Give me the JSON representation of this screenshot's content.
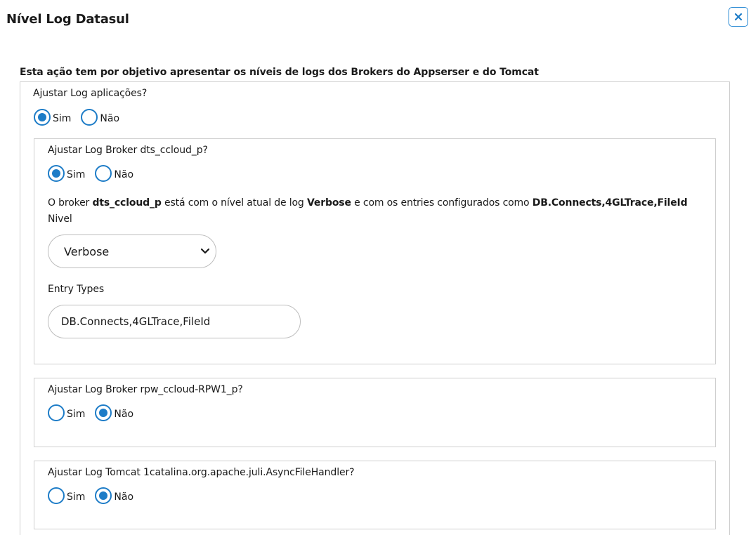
{
  "dialog": {
    "title": "Nível Log Datasul",
    "close_icon": "close-icon"
  },
  "description": "Esta ação tem por objetivo apresentar os níveis de logs dos Brokers do Appserser e do Tomcat",
  "main_question": {
    "label": "Ajustar Log aplicações?",
    "options": [
      "Sim",
      "Não"
    ],
    "selected": "Sim"
  },
  "broker1": {
    "label": "Ajustar Log Broker dts_ccloud_p?",
    "options": [
      "Sim",
      "Não"
    ],
    "selected": "Sim",
    "info": {
      "prefix": "O broker ",
      "broker_name": "dts_ccloud_p",
      "mid": " está com o nível atual de log ",
      "level": "Verbose",
      "mid2": " e com os entries configurados como ",
      "entries": "DB.Connects,4GLTrace,FileId"
    },
    "level_label": "Nivel",
    "level_value": "Verbose",
    "entry_label": "Entry Types",
    "entry_value": "DB.Connects,4GLTrace,FileId"
  },
  "broker2": {
    "label": "Ajustar Log Broker rpw_ccloud-RPW1_p?",
    "options": [
      "Sim",
      "Não"
    ],
    "selected": "Não"
  },
  "tomcat": {
    "label": "Ajustar Log Tomcat 1catalina.org.apache.juli.AsyncFileHandler?",
    "options": [
      "Sim",
      "Não"
    ],
    "selected": "Não"
  },
  "colors": {
    "accent": "#1d7cc7",
    "border": "#cfcfcf"
  }
}
